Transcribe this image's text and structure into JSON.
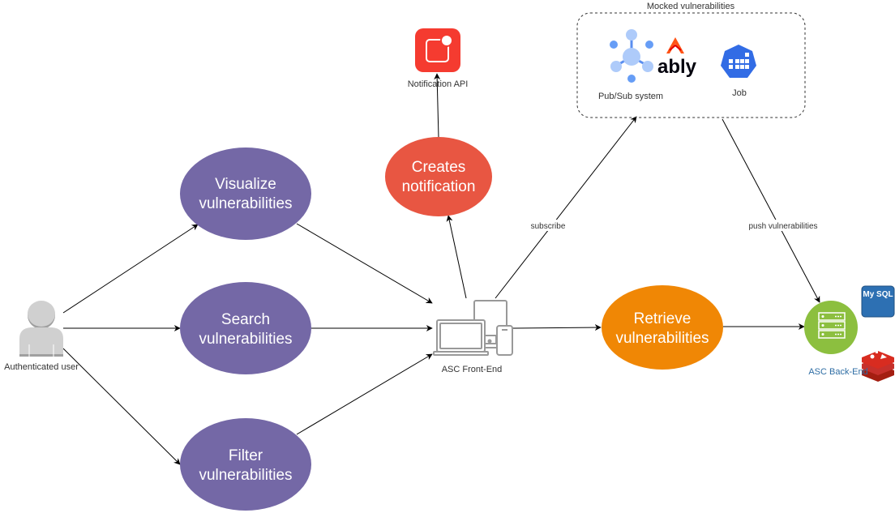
{
  "colors": {
    "use_case_purple": "#7468a6",
    "notification_red": "#e85642",
    "retrieve_orange": "#f08705",
    "backend_green": "#8cbf3f",
    "notification_api_red": "#f53b30",
    "device_gray": "#999999",
    "user_gray": "#d0d0d0",
    "backend_label_blue": "#2e6da4"
  },
  "actors": {
    "user": {
      "label": "Authenticated user",
      "icon": "user-icon"
    }
  },
  "use_cases": [
    {
      "id": "visualize",
      "line1": "Visualize",
      "line2": "vulnerabilities"
    },
    {
      "id": "search",
      "line1": "Search",
      "line2": "vulnerabilities"
    },
    {
      "id": "filter",
      "line1": "Filter",
      "line2": "vulnerabilities"
    },
    {
      "id": "creates",
      "line1": "Creates",
      "line2": "notification"
    },
    {
      "id": "retrieve",
      "line1": "Retrieve",
      "line2": "vulnerabilities"
    }
  ],
  "components": {
    "frontend": {
      "label": "ASC Front-End",
      "icon": "devices-icon"
    },
    "backend": {
      "label": "ASC Back-End",
      "icon": "server-icon",
      "db_label": "My SQL",
      "cache_icon": "redis-icon"
    },
    "notification_api": {
      "label": "Notification API",
      "icon": "notification-icon"
    }
  },
  "mocked_group": {
    "title": "Mocked vulnerabilities",
    "pubsub": {
      "label": "Pub/Sub system",
      "brand": "ably"
    },
    "job": {
      "label": "Job"
    }
  },
  "edge_labels": {
    "subscribe": "subscribe",
    "push": "push vulnerabilities"
  }
}
